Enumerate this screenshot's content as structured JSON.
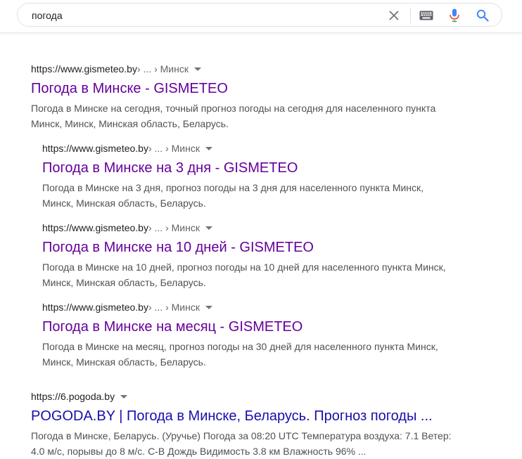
{
  "search": {
    "query": "погода"
  },
  "colors": {
    "visited_link": "#660099",
    "link": "#1a0dab",
    "snippet": "#4d5156",
    "url": "#202124"
  },
  "results": [
    {
      "url": "https://www.gismeteo.by",
      "crumbs": " › ... › Минск",
      "title": "Погода в Минске - GISMETEO",
      "snippet_line1": "Погода в Минске на сегодня, точный прогноз погоды на сегодня для населенного пункта",
      "snippet_line2": "Минск, Минск, Минская область, Беларусь."
    },
    {
      "url": "https://www.gismeteo.by",
      "crumbs": " › ... › Минск",
      "title": "Погода в Минске на 3 дня - GISMETEO",
      "snippet_line1": "Погода в Минске на 3 дня, прогноз погоды на 3 дня для населенного пункта Минск,",
      "snippet_line2": "Минск, Минская область, Беларусь."
    },
    {
      "url": "https://www.gismeteo.by",
      "crumbs": " › ... › Минск",
      "title": "Погода в Минске на 10 дней - GISMETEO",
      "snippet_line1": "Погода в Минске на 10 дней, прогноз погоды на 10 дней для населенного пункта Минск,",
      "snippet_line2": "Минск, Минская область, Беларусь."
    },
    {
      "url": "https://www.gismeteo.by",
      "crumbs": " › ... › Минск",
      "title": "Погода в Минске на месяц - GISMETEO",
      "snippet_line1": "Погода в Минске на месяц, прогноз погоды на 30 дней для населенного пункта Минск,",
      "snippet_line2": "Минск, Минская область, Беларусь."
    },
    {
      "url": "https://6.pogoda.by",
      "crumbs": "",
      "title": "POGODA.BY | Погода в Минске, Беларусь. Прогноз погоды ...",
      "snippet_line1": "Погода в Минске, Беларусь. (Уручье) Погода за 08:20 UTC Температура воздуха: 7.1 Ветер:",
      "snippet_line2": "4.0 м/с, порывы до 8 м/с. С-В Дождь Видимость 3.8 км Влажность 96% ..."
    }
  ]
}
